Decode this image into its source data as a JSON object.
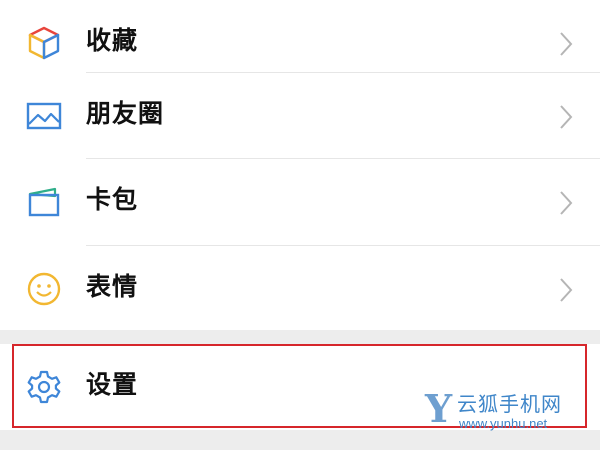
{
  "menu": {
    "items": [
      {
        "label": "收藏",
        "icon": "favorites-cube-icon"
      },
      {
        "label": "朋友圈",
        "icon": "moments-image-icon"
      },
      {
        "label": "卡包",
        "icon": "cards-wallet-icon"
      },
      {
        "label": "表情",
        "icon": "stickers-smiley-icon"
      }
    ],
    "settings": {
      "label": "设置",
      "icon": "gear-icon"
    }
  },
  "highlight_color": "#d6262b",
  "watermark": {
    "letter": "Y",
    "name": "云狐手机网",
    "url": "www.yunhu.net"
  }
}
